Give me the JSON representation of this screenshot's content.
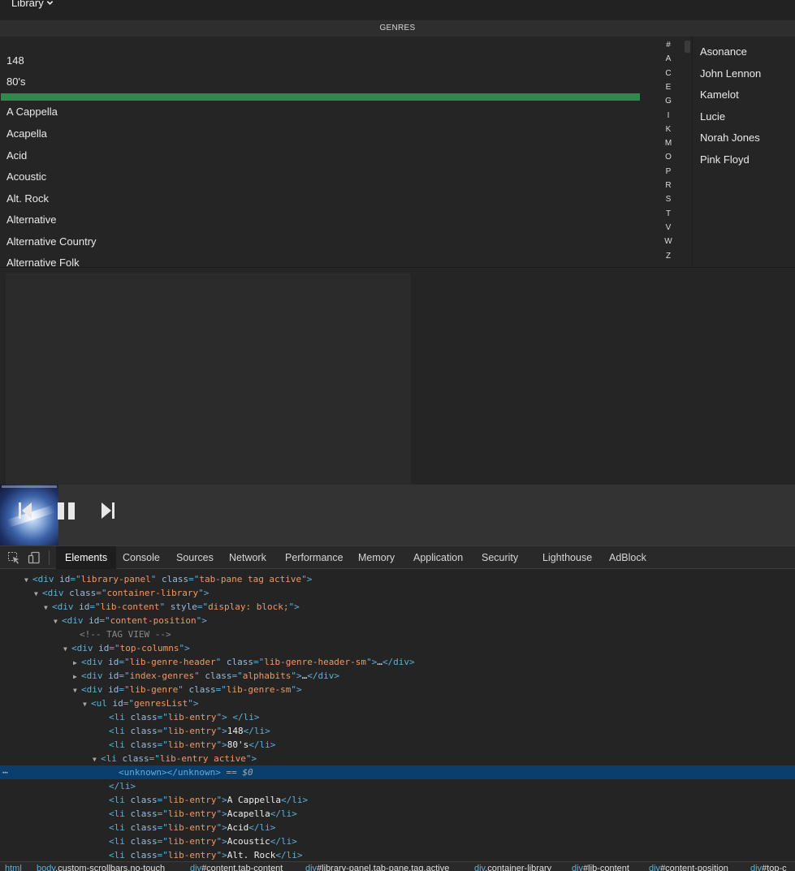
{
  "topbar": {
    "library_label": "Library"
  },
  "genres_header": "GENRES",
  "genres": [
    "148",
    "80's",
    "A Cappella",
    "Acapella",
    "Acid",
    "Acoustic",
    "Alt. Rock",
    "Alternative",
    "Alternative Country",
    "Alternative Folk"
  ],
  "active_genre_index": 2,
  "alpha_index": [
    "#",
    "A",
    "C",
    "E",
    "G",
    "I",
    "K",
    "M",
    "O",
    "P",
    "R",
    "S",
    "T",
    "V",
    "W",
    "Z"
  ],
  "artists": [
    "Asonance",
    "John Lennon",
    "Kamelot",
    "Lucie",
    "Norah Jones",
    "Pink Floyd"
  ],
  "player": {
    "prev_icon": "skip-previous-icon",
    "pause_icon": "pause-icon",
    "next_icon": "skip-next-icon"
  },
  "devtools": {
    "tabs": [
      "Elements",
      "Console",
      "Sources",
      "Network",
      "Performance",
      "Memory",
      "Application",
      "Security",
      "Lighthouse",
      "AdBlock"
    ],
    "active_tab": "Elements",
    "tree": [
      {
        "indent": 40,
        "tri": "open",
        "parts": [
          [
            "tg",
            "<div "
          ],
          [
            "an",
            "id"
          ],
          [
            "tg",
            "=\""
          ],
          [
            "av",
            "library-panel"
          ],
          [
            "tg",
            "\" "
          ],
          [
            "an",
            "class"
          ],
          [
            "tg",
            "=\""
          ],
          [
            "av",
            "tab-pane tag active"
          ],
          [
            "tg",
            "\">"
          ]
        ]
      },
      {
        "indent": 52,
        "tri": "open",
        "parts": [
          [
            "tg",
            "<div "
          ],
          [
            "an",
            "class"
          ],
          [
            "tg",
            "=\""
          ],
          [
            "av",
            "container-library"
          ],
          [
            "tg",
            "\">"
          ]
        ]
      },
      {
        "indent": 64,
        "tri": "open",
        "parts": [
          [
            "tg",
            "<div "
          ],
          [
            "an",
            "id"
          ],
          [
            "tg",
            "=\""
          ],
          [
            "av",
            "lib-content"
          ],
          [
            "tg",
            "\" "
          ],
          [
            "an",
            "style"
          ],
          [
            "tg",
            "=\""
          ],
          [
            "av",
            "display: block;"
          ],
          [
            "tg",
            "\">"
          ]
        ]
      },
      {
        "indent": 76,
        "tri": "open",
        "parts": [
          [
            "tg",
            "<div "
          ],
          [
            "an",
            "id"
          ],
          [
            "tg",
            "=\""
          ],
          [
            "av",
            "content-position"
          ],
          [
            "tg",
            "\">"
          ]
        ]
      },
      {
        "indent": 98,
        "tri": "",
        "parts": [
          [
            "cm",
            "<!-- TAG VIEW -->"
          ]
        ]
      },
      {
        "indent": 88,
        "tri": "open",
        "parts": [
          [
            "tg",
            "<div "
          ],
          [
            "an",
            "id"
          ],
          [
            "tg",
            "=\""
          ],
          [
            "av",
            "top-columns"
          ],
          [
            "tg",
            "\">"
          ]
        ]
      },
      {
        "indent": 100,
        "tri": "closed",
        "parts": [
          [
            "tg",
            "<div "
          ],
          [
            "an",
            "id"
          ],
          [
            "tg",
            "=\""
          ],
          [
            "av",
            "lib-genre-header"
          ],
          [
            "tg",
            "\" "
          ],
          [
            "an",
            "class"
          ],
          [
            "tg",
            "=\""
          ],
          [
            "av",
            "lib-genre-header-sm"
          ],
          [
            "tg",
            "\">"
          ],
          [
            "tx",
            "…"
          ],
          [
            "tg",
            "</div>"
          ]
        ]
      },
      {
        "indent": 100,
        "tri": "closed",
        "parts": [
          [
            "tg",
            "<div "
          ],
          [
            "an",
            "id"
          ],
          [
            "tg",
            "=\""
          ],
          [
            "av",
            "index-genres"
          ],
          [
            "tg",
            "\" "
          ],
          [
            "an",
            "class"
          ],
          [
            "tg",
            "=\""
          ],
          [
            "av",
            "alphabits"
          ],
          [
            "tg",
            "\">"
          ],
          [
            "tx",
            "…"
          ],
          [
            "tg",
            "</div>"
          ]
        ]
      },
      {
        "indent": 100,
        "tri": "open",
        "parts": [
          [
            "tg",
            "<div "
          ],
          [
            "an",
            "id"
          ],
          [
            "tg",
            "=\""
          ],
          [
            "av",
            "lib-genre"
          ],
          [
            "tg",
            "\" "
          ],
          [
            "an",
            "class"
          ],
          [
            "tg",
            "=\""
          ],
          [
            "av",
            "lib-genre-sm"
          ],
          [
            "tg",
            "\">"
          ]
        ]
      },
      {
        "indent": 112,
        "tri": "open",
        "parts": [
          [
            "tg",
            "<ul "
          ],
          [
            "an",
            "id"
          ],
          [
            "tg",
            "=\""
          ],
          [
            "av",
            "genresList"
          ],
          [
            "tg",
            "\">"
          ]
        ]
      },
      {
        "indent": 134,
        "tri": "",
        "parts": [
          [
            "tg",
            "<li "
          ],
          [
            "an",
            "class"
          ],
          [
            "tg",
            "=\""
          ],
          [
            "av",
            "lib-entry"
          ],
          [
            "tg",
            "\">"
          ],
          [
            "tx",
            " "
          ],
          [
            "tg",
            "</li>"
          ]
        ]
      },
      {
        "indent": 134,
        "tri": "",
        "parts": [
          [
            "tg",
            "<li "
          ],
          [
            "an",
            "class"
          ],
          [
            "tg",
            "=\""
          ],
          [
            "av",
            "lib-entry"
          ],
          [
            "tg",
            "\">"
          ],
          [
            "tx",
            "148"
          ],
          [
            "tg",
            "</li>"
          ]
        ]
      },
      {
        "indent": 134,
        "tri": "",
        "parts": [
          [
            "tg",
            "<li "
          ],
          [
            "an",
            "class"
          ],
          [
            "tg",
            "=\""
          ],
          [
            "av",
            "lib-entry"
          ],
          [
            "tg",
            "\">"
          ],
          [
            "tx",
            "80's"
          ],
          [
            "tg",
            "</li>"
          ]
        ]
      },
      {
        "indent": 124,
        "tri": "open",
        "parts": [
          [
            "tg",
            "<li "
          ],
          [
            "an",
            "class"
          ],
          [
            "tg",
            "=\""
          ],
          [
            "av",
            "lib-entry active"
          ],
          [
            "tg",
            "\">"
          ]
        ]
      },
      {
        "indent": 146,
        "tri": "",
        "selected": true,
        "parts": [
          [
            "tg",
            "<unknown></unknown>"
          ],
          [
            "eq",
            " == "
          ],
          [
            "sv",
            "$0"
          ]
        ]
      },
      {
        "indent": 134,
        "tri": "",
        "parts": [
          [
            "tg",
            "</li>"
          ]
        ]
      },
      {
        "indent": 134,
        "tri": "",
        "parts": [
          [
            "tg",
            "<li "
          ],
          [
            "an",
            "class"
          ],
          [
            "tg",
            "=\""
          ],
          [
            "av",
            "lib-entry"
          ],
          [
            "tg",
            "\">"
          ],
          [
            "tx",
            "A Cappella"
          ],
          [
            "tg",
            "</li>"
          ]
        ]
      },
      {
        "indent": 134,
        "tri": "",
        "parts": [
          [
            "tg",
            "<li "
          ],
          [
            "an",
            "class"
          ],
          [
            "tg",
            "=\""
          ],
          [
            "av",
            "lib-entry"
          ],
          [
            "tg",
            "\">"
          ],
          [
            "tx",
            "Acapella"
          ],
          [
            "tg",
            "</li>"
          ]
        ]
      },
      {
        "indent": 134,
        "tri": "",
        "parts": [
          [
            "tg",
            "<li "
          ],
          [
            "an",
            "class"
          ],
          [
            "tg",
            "=\""
          ],
          [
            "av",
            "lib-entry"
          ],
          [
            "tg",
            "\">"
          ],
          [
            "tx",
            "Acid"
          ],
          [
            "tg",
            "</li>"
          ]
        ]
      },
      {
        "indent": 134,
        "tri": "",
        "parts": [
          [
            "tg",
            "<li "
          ],
          [
            "an",
            "class"
          ],
          [
            "tg",
            "=\""
          ],
          [
            "av",
            "lib-entry"
          ],
          [
            "tg",
            "\">"
          ],
          [
            "tx",
            "Acoustic"
          ],
          [
            "tg",
            "</li>"
          ]
        ]
      },
      {
        "indent": 134,
        "tri": "",
        "parts": [
          [
            "tg",
            "<li "
          ],
          [
            "an",
            "class"
          ],
          [
            "tg",
            "=\""
          ],
          [
            "av",
            "lib-entry"
          ],
          [
            "tg",
            "\">"
          ],
          [
            "tx",
            "Alt. Rock"
          ],
          [
            "tg",
            "</li>"
          ]
        ]
      }
    ],
    "breadcrumbs": [
      [
        "html",
        ""
      ],
      [
        "body",
        ".custom-scrollbars.no-touch"
      ],
      [
        "div",
        "#content.tab-content"
      ],
      [
        "div",
        "#library-panel.tab-pane.tag.active"
      ],
      [
        "div",
        ".container-library"
      ],
      [
        "div",
        "#lib-content"
      ],
      [
        "div",
        "#content-position"
      ],
      [
        "div",
        "#top-c"
      ]
    ]
  }
}
